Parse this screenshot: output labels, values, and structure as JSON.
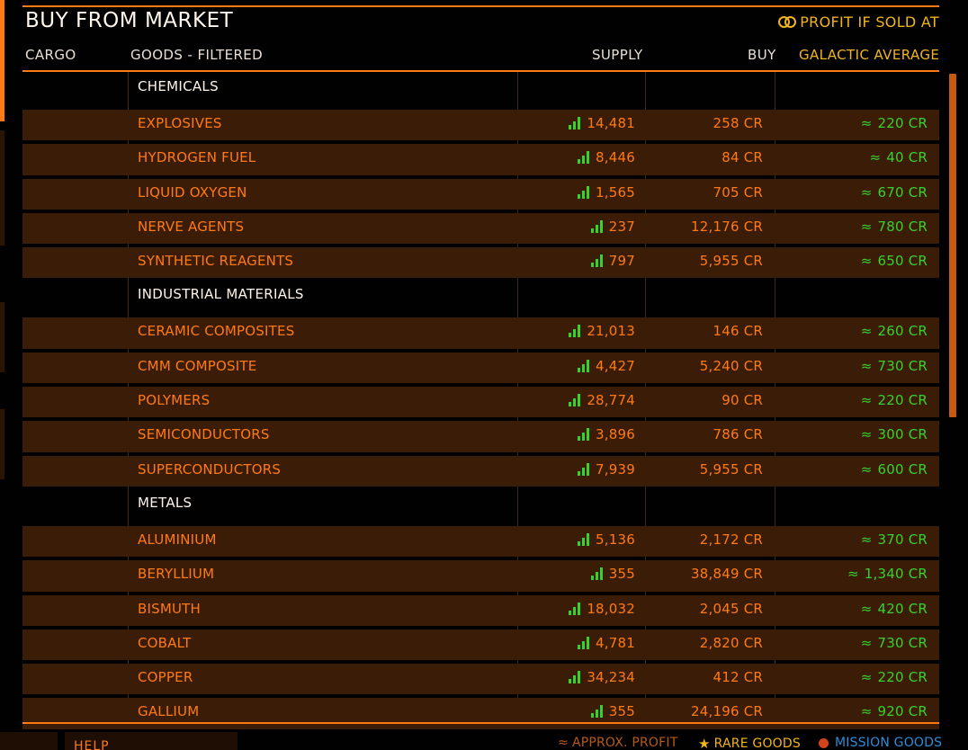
{
  "title": "BUY FROM MARKET",
  "profit_header": "PROFIT IF SOLD AT",
  "columns": {
    "cargo": "CARGO",
    "goods": "GOODS - FILTERED",
    "supply": "SUPPLY",
    "buy": "BUY",
    "galactic": "GALACTIC AVERAGE"
  },
  "approx_symbol": "≈",
  "categories": [
    {
      "name": "CHEMICALS",
      "items": [
        {
          "name": "EXPLOSIVES",
          "supply": "14,481",
          "buy": "258 CR",
          "avg": "220 CR"
        },
        {
          "name": "HYDROGEN FUEL",
          "supply": "8,446",
          "buy": "84 CR",
          "avg": "40 CR"
        },
        {
          "name": "LIQUID OXYGEN",
          "supply": "1,565",
          "buy": "705 CR",
          "avg": "670 CR"
        },
        {
          "name": "NERVE AGENTS",
          "supply": "237",
          "buy": "12,176 CR",
          "avg": "780 CR"
        },
        {
          "name": "SYNTHETIC REAGENTS",
          "supply": "797",
          "buy": "5,955 CR",
          "avg": "650 CR"
        }
      ]
    },
    {
      "name": "INDUSTRIAL MATERIALS",
      "items": [
        {
          "name": "CERAMIC COMPOSITES",
          "supply": "21,013",
          "buy": "146 CR",
          "avg": "260 CR"
        },
        {
          "name": "CMM COMPOSITE",
          "supply": "4,427",
          "buy": "5,240 CR",
          "avg": "730 CR"
        },
        {
          "name": "POLYMERS",
          "supply": "28,774",
          "buy": "90 CR",
          "avg": "220 CR"
        },
        {
          "name": "SEMICONDUCTORS",
          "supply": "3,896",
          "buy": "786 CR",
          "avg": "300 CR"
        },
        {
          "name": "SUPERCONDUCTORS",
          "supply": "7,939",
          "buy": "5,955 CR",
          "avg": "600 CR"
        }
      ]
    },
    {
      "name": "METALS",
      "items": [
        {
          "name": "ALUMINIUM",
          "supply": "5,136",
          "buy": "2,172 CR",
          "avg": "370 CR"
        },
        {
          "name": "BERYLLIUM",
          "supply": "355",
          "buy": "38,849 CR",
          "avg": "1,340 CR"
        },
        {
          "name": "BISMUTH",
          "supply": "18,032",
          "buy": "2,045 CR",
          "avg": "420 CR"
        },
        {
          "name": "COBALT",
          "supply": "4,781",
          "buy": "2,820 CR",
          "avg": "730 CR"
        },
        {
          "name": "COPPER",
          "supply": "34,234",
          "buy": "412 CR",
          "avg": "220 CR"
        },
        {
          "name": "GALLIUM",
          "supply": "355",
          "buy": "24,196 CR",
          "avg": "920 CR"
        }
      ]
    }
  ],
  "footer": {
    "help": "HELP",
    "approx_profit": "APPROX. PROFIT",
    "rare_goods": "RARE GOODS",
    "mission_goods": "MISSION GOODS"
  },
  "colors": {
    "accent": "#ff7a14",
    "row_bg": "#3a1c07",
    "profit": "#39d12c",
    "gold": "#f0b41e",
    "mission": "#2e8cd8"
  },
  "icons": {
    "profit": "linked-rings-icon",
    "supply": "signal-bars-icon",
    "rare": "star-icon",
    "mission": "globe-icon"
  }
}
